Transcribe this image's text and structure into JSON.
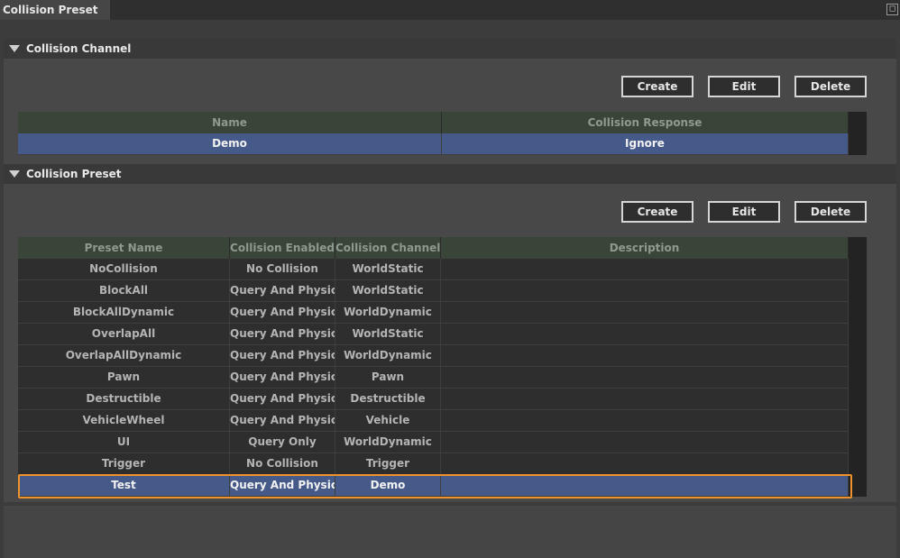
{
  "tab": {
    "title": "Collision Preset"
  },
  "channel_section": {
    "title": "Collision Channel",
    "buttons": {
      "create": "Create",
      "edit": "Edit",
      "delete": "Delete"
    },
    "columns": [
      "Name",
      "Collision Response"
    ],
    "rows": [
      {
        "name": "Demo",
        "response": "Ignore",
        "selected": true
      }
    ]
  },
  "preset_section": {
    "title": "Collision Preset",
    "buttons": {
      "create": "Create",
      "edit": "Edit",
      "delete": "Delete"
    },
    "columns": [
      "Preset Name",
      "Collision Enabled",
      "Collision Channel",
      "Description"
    ],
    "rows": [
      {
        "name": "NoCollision",
        "enabled": "No Collision",
        "channel": "WorldStatic",
        "description": ""
      },
      {
        "name": "BlockAll",
        "enabled": "Query And Physics",
        "channel": "WorldStatic",
        "description": ""
      },
      {
        "name": "BlockAllDynamic",
        "enabled": "Query And Physics",
        "channel": "WorldDynamic",
        "description": ""
      },
      {
        "name": "OverlapAll",
        "enabled": "Query And Physics",
        "channel": "WorldStatic",
        "description": ""
      },
      {
        "name": "OverlapAllDynamic",
        "enabled": "Query And Physics",
        "channel": "WorldDynamic",
        "description": ""
      },
      {
        "name": "Pawn",
        "enabled": "Query And Physics",
        "channel": "Pawn",
        "description": ""
      },
      {
        "name": "Destructible",
        "enabled": "Query And Physics",
        "channel": "Destructible",
        "description": ""
      },
      {
        "name": "VehicleWheel",
        "enabled": "Query And Physics",
        "channel": "Vehicle",
        "description": ""
      },
      {
        "name": "UI",
        "enabled": "Query Only",
        "channel": "WorldDynamic",
        "description": ""
      },
      {
        "name": "Trigger",
        "enabled": "No Collision",
        "channel": "Trigger",
        "description": ""
      },
      {
        "name": "Test",
        "enabled": "Query And Physics",
        "channel": "Demo",
        "description": "",
        "selected": true,
        "highlighted": true
      }
    ]
  },
  "colors": {
    "selection": "#465a8a",
    "header": "#394539",
    "highlight": "#f0922a"
  },
  "icons": {
    "collapse": "triangle-down-icon",
    "pin": "pin-icon"
  }
}
